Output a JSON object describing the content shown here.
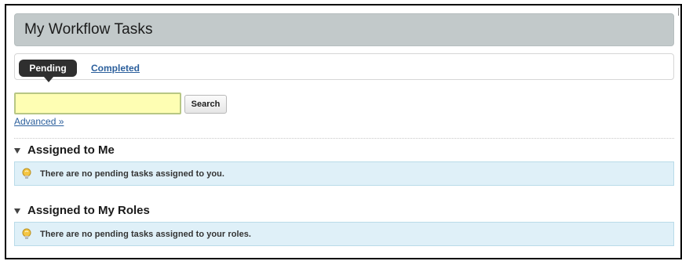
{
  "page": {
    "title": "My Workflow Tasks"
  },
  "tabs": {
    "items": [
      {
        "label": "Pending",
        "active": true
      },
      {
        "label": "Completed",
        "active": false
      }
    ]
  },
  "search": {
    "value": "",
    "placeholder": "",
    "button_label": "Search",
    "advanced_label": "Advanced »"
  },
  "sections": [
    {
      "title": "Assigned to Me",
      "icon": "triangle-down-icon",
      "message": "There are no pending tasks assigned to you.",
      "message_icon": "lightbulb-icon"
    },
    {
      "title": "Assigned to My Roles",
      "icon": "triangle-down-icon",
      "message": "There are no pending tasks assigned to your roles.",
      "message_icon": "lightbulb-icon"
    }
  ],
  "colors": {
    "title_bar": "#c2c9ca",
    "active_tab": "#2f2f2f",
    "link": "#2b5f9c",
    "search_bg": "#fefeb3",
    "info_bg": "#dff0f8",
    "info_border": "#b9dbe9"
  }
}
